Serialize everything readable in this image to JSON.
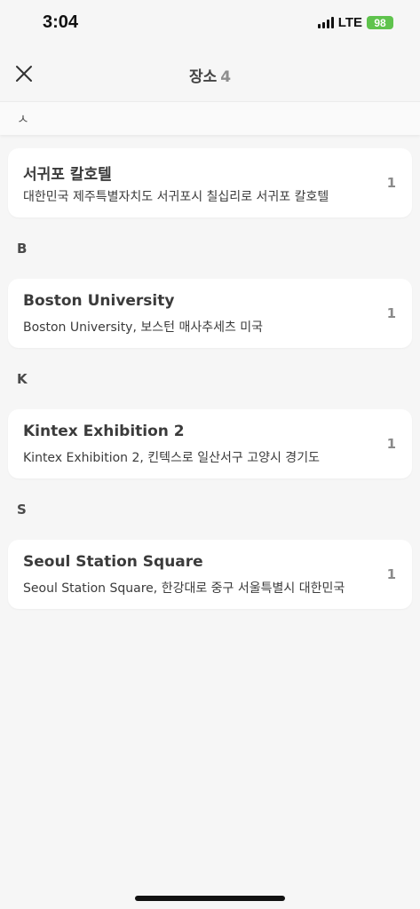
{
  "status_bar": {
    "time": "3:04",
    "network": "LTE",
    "battery": "98"
  },
  "nav": {
    "title": "장소",
    "count": "4",
    "close_icon": "close-icon"
  },
  "sticky_section": "ㅅ",
  "sections": [
    {
      "label": "",
      "items": [
        {
          "title": "서귀포 칼호텔",
          "subtitle": "대한민국 제주특별자치도 서귀포시 칠십리로 서귀포 칼호텔",
          "count": "1"
        }
      ]
    },
    {
      "label": "B",
      "items": [
        {
          "title": "Boston University",
          "subtitle": "Boston University, 보스턴 매사추세츠 미국",
          "count": "1"
        }
      ]
    },
    {
      "label": "K",
      "items": [
        {
          "title": "Kintex Exhibition 2",
          "subtitle": "Kintex Exhibition 2, 킨텍스로 일산서구 고양시 경기도",
          "count": "1"
        }
      ]
    },
    {
      "label": "S",
      "items": [
        {
          "title": "Seoul Station Square",
          "subtitle": "Seoul Station Square, 한강대로 중구 서울특별시 대한민국",
          "count": "1"
        }
      ]
    }
  ],
  "colors": {
    "background": "#f6f6f6",
    "card": "#ffffff",
    "battery": "#5fc34d"
  }
}
